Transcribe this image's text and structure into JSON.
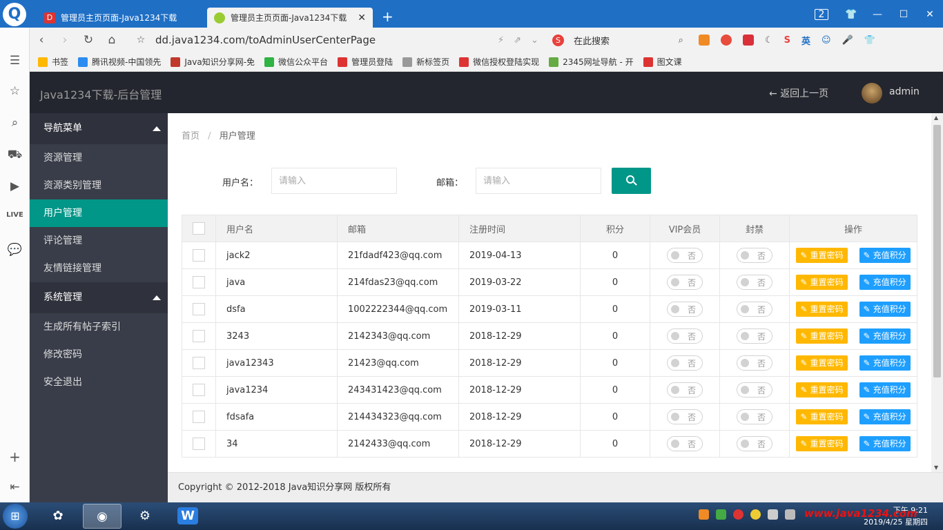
{
  "browser": {
    "tabs": [
      {
        "title": "管理员主页页面-Java1234下载",
        "favicon": "D"
      },
      {
        "title": "管理员主页页面-Java1234下载",
        "close": "✕"
      }
    ],
    "window_count": "2",
    "url": "dd.java1234.com/toAdminUserCenterPage",
    "search_placeholder": "在此搜索",
    "bookmarks": [
      "书签",
      "腾讯视频-中国领先",
      "Java知识分享网-免",
      "微信公众平台",
      "管理员登陆",
      "新标签页",
      "微信授权登陆实现",
      "2345网址导航 - 开",
      "图文课"
    ],
    "bookmark_colors": [
      "#ffb800",
      "#2d8cf0",
      "#c0392b",
      "#2fb344",
      "#d33",
      "#999",
      "#d33",
      "#6a4",
      "#d33"
    ],
    "ime_label": "英"
  },
  "header": {
    "title": "Java1234下载-后台管理",
    "back_label": "返回上一页",
    "user": "admin"
  },
  "sidebar": {
    "group1": "导航菜单",
    "items1": [
      "资源管理",
      "资源类别管理",
      "用户管理",
      "评论管理",
      "友情链接管理"
    ],
    "group2": "系统管理",
    "items2": [
      "生成所有帖子索引",
      "修改密码",
      "安全退出"
    ]
  },
  "breadcrumb": {
    "home": "首页",
    "sep": "/",
    "current": "用户管理"
  },
  "filters": {
    "username_label": "用户名：",
    "username_placeholder": "请输入",
    "email_label": "邮箱：",
    "email_placeholder": "请输入"
  },
  "table": {
    "headers": [
      "用户名",
      "邮箱",
      "注册时间",
      "积分",
      "VIP会员",
      "封禁",
      "操作"
    ],
    "switch_off_text": "否",
    "reset_label": "重置密码",
    "recharge_label": "充值积分",
    "rows": [
      {
        "name": "jack2",
        "email": "21fdadf423@qq.com",
        "date": "2019-04-13",
        "points": "0"
      },
      {
        "name": "java",
        "email": "214fdas23@qq.com",
        "date": "2019-03-22",
        "points": "0"
      },
      {
        "name": "dsfa",
        "email": "1002222344@qq.com",
        "date": "2019-03-11",
        "points": "0"
      },
      {
        "name": "3243",
        "email": "2142343@qq.com",
        "date": "2018-12-29",
        "points": "0"
      },
      {
        "name": "java12343",
        "email": "21423@qq.com",
        "date": "2018-12-29",
        "points": "0"
      },
      {
        "name": "java1234",
        "email": "243431423@qq.com",
        "date": "2018-12-29",
        "points": "0"
      },
      {
        "name": "fdsafa",
        "email": "214434323@qq.com",
        "date": "2018-12-29",
        "points": "0"
      },
      {
        "name": "34",
        "email": "2142433@qq.com",
        "date": "2018-12-29",
        "points": "0"
      }
    ]
  },
  "footer": "Copyright © 2012-2018 Java知识分享网 版权所有",
  "taskbar": {
    "time": "下午 9:21",
    "date": "2019/4/25 星期四",
    "watermark": "www.java1234.com"
  },
  "colors": {
    "accent": "#009688",
    "warn": "#ffb800",
    "blue": "#1e9fff",
    "sidebar": "#393d49",
    "header": "#23262e"
  }
}
